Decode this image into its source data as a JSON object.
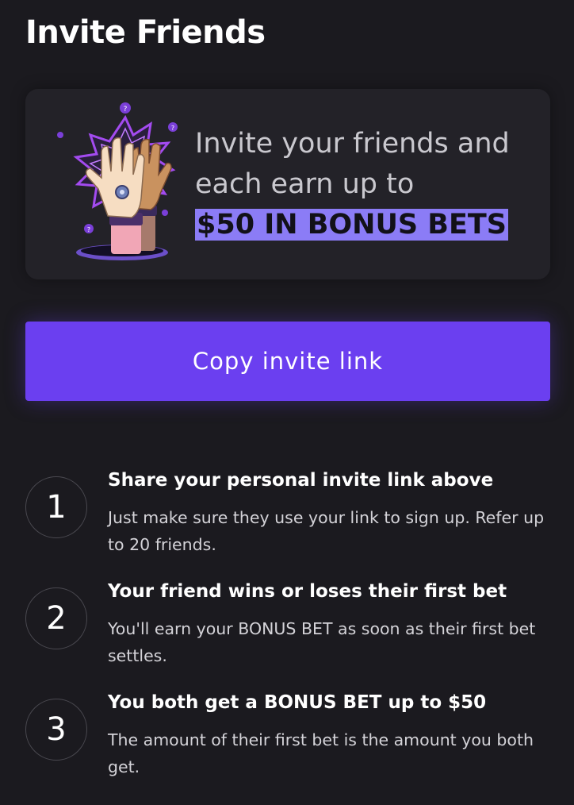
{
  "page": {
    "title": "Invite Friends"
  },
  "promo": {
    "line1": "Invite your friends and",
    "line2": "each earn up to",
    "highlight": "$50 IN BONUS BETS"
  },
  "actions": {
    "copy_label": "Copy invite link"
  },
  "steps": [
    {
      "number": "1",
      "title": "Share your personal invite link above",
      "description": "Just make sure they use your link to sign up. Refer up to 20 friends."
    },
    {
      "number": "2",
      "title": "Your friend wins or loses their first bet",
      "description": "You'll earn your BONUS BET as soon as their first bet settles."
    },
    {
      "number": "3",
      "title": "You both get a BONUS BET up to $50",
      "description": "The amount of their first bet is the amount you both get."
    }
  ],
  "colors": {
    "background": "#1b1a1f",
    "card": "#232228",
    "accent": "#6b3ff0",
    "highlight": "#8b7cf6"
  },
  "icons": {
    "promo_illustration": "high-five-hands-portal-illustration"
  }
}
